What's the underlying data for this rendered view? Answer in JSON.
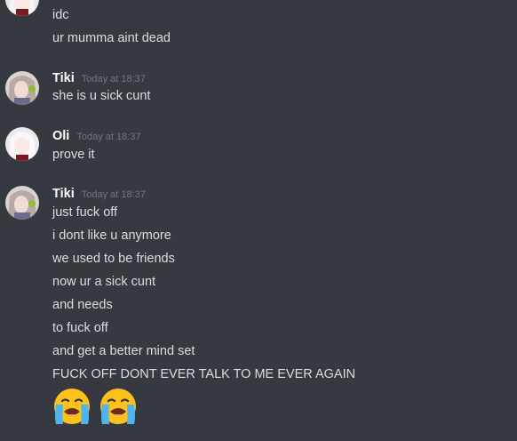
{
  "messages": {
    "group0": {
      "lines": [
        "idc",
        "ur mumma aint dead"
      ]
    },
    "group1": {
      "username": "Tiki",
      "timestamp": "Today at 18:37",
      "lines": [
        "she is u sick cunt"
      ]
    },
    "group2": {
      "username": "Oli",
      "timestamp": "Today at 18:37",
      "lines": [
        "prove it"
      ]
    },
    "group3": {
      "username": "Tiki",
      "timestamp": "Today at 18:37",
      "lines": [
        "just fuck off",
        "i dont like u anymore",
        "we used to be friends",
        "now ur a sick cunt",
        "and needs",
        "to fuck off",
        "and get a better mind set",
        "FUCK OFF DONT EVER TALK TO ME EVER AGAIN"
      ],
      "emojis": [
        "loudly-crying-face-icon",
        "loudly-crying-face-icon"
      ]
    }
  },
  "colors": {
    "background": "#36393f",
    "username": "#ffffff",
    "timestamp": "#72767d",
    "text": "#dcddde"
  }
}
